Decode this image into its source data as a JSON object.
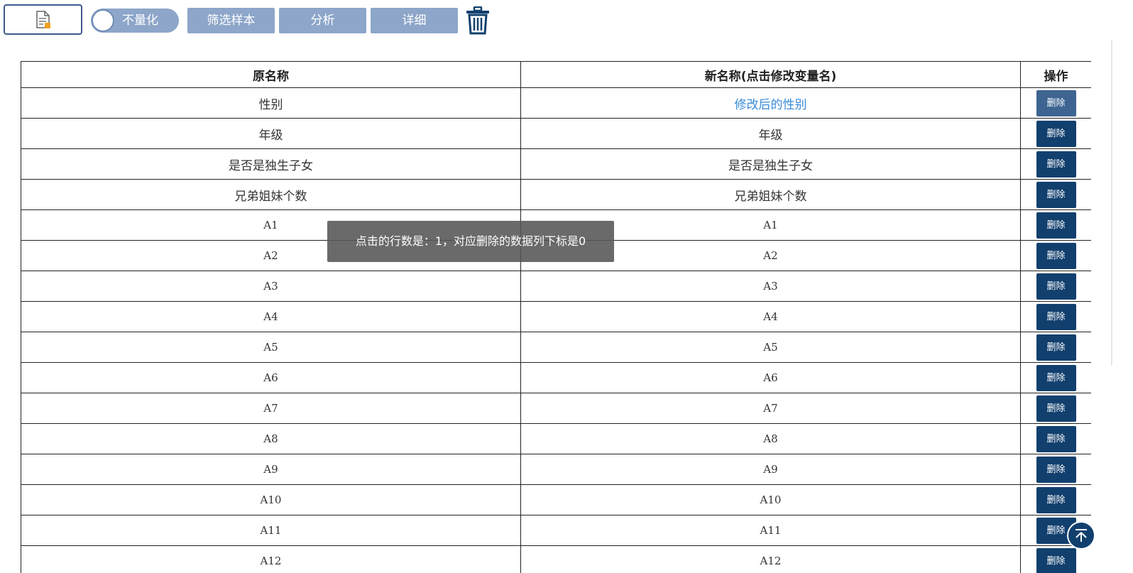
{
  "toolbar": {
    "file_icon": "file-doc-icon",
    "toggle_label": "不量化",
    "filter_label": "筛选样本",
    "analyze_label": "分析",
    "detail_label": "详细",
    "trash_icon": "trash-icon"
  },
  "table": {
    "headers": [
      "原名称",
      "新名称(点击修改变量名)",
      "操作"
    ],
    "delete_label": "删除",
    "rows": [
      {
        "original": "性别",
        "renamed": "修改后的性别"
      },
      {
        "original": "年级",
        "renamed": "年级"
      },
      {
        "original": "是否是独生子女",
        "renamed": "是否是独生子女"
      },
      {
        "original": "兄弟姐妹个数",
        "renamed": "兄弟姐妹个数"
      },
      {
        "original": "A1",
        "renamed": "A1"
      },
      {
        "original": "A2",
        "renamed": "A2"
      },
      {
        "original": "A3",
        "renamed": "A3"
      },
      {
        "original": "A4",
        "renamed": "A4"
      },
      {
        "original": "A5",
        "renamed": "A5"
      },
      {
        "original": "A6",
        "renamed": "A6"
      },
      {
        "original": "A7",
        "renamed": "A7"
      },
      {
        "original": "A8",
        "renamed": "A8"
      },
      {
        "original": "A9",
        "renamed": "A9"
      },
      {
        "original": "A10",
        "renamed": "A10"
      },
      {
        "original": "A11",
        "renamed": "A11"
      },
      {
        "original": "A12",
        "renamed": "A12"
      }
    ]
  },
  "toast": {
    "message": "点击的行数是：1，对应删除的数据列下标是0"
  },
  "back_to_top_icon": "arrow-up-to-top-icon",
  "colors": {
    "toolbar_button": "#8da6c9",
    "delete_button": "#12406e",
    "delete_button_hover": "#3e6591",
    "link_text": "#3a8ad8",
    "toast_bg": "#555555"
  }
}
